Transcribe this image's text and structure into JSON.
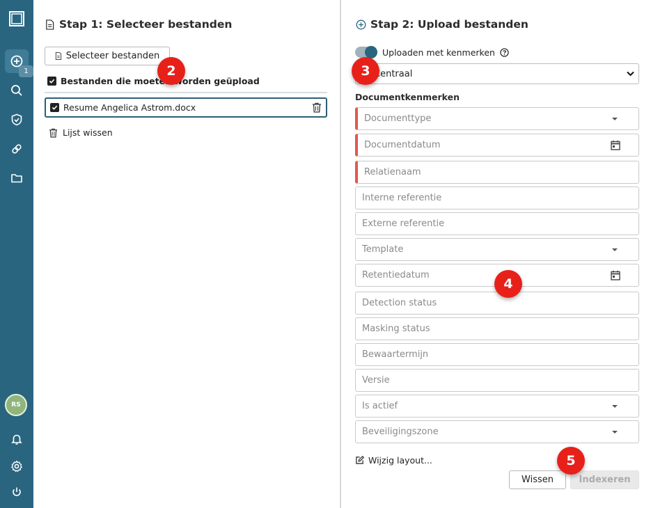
{
  "sidebar": {
    "badge_count": "1",
    "avatar_initials": "RS",
    "items": [
      {
        "name": "logo",
        "icon": "window-icon"
      },
      {
        "name": "upload",
        "icon": "plus-circle-icon"
      },
      {
        "name": "search",
        "icon": "search-icon"
      },
      {
        "name": "security",
        "icon": "shield-icon"
      },
      {
        "name": "integrations",
        "icon": "link-icon"
      },
      {
        "name": "folders",
        "icon": "folder-icon"
      },
      {
        "name": "notifications",
        "icon": "bell-icon"
      },
      {
        "name": "settings",
        "icon": "gear-icon"
      },
      {
        "name": "logout",
        "icon": "power-icon"
      }
    ]
  },
  "step1": {
    "title": "Stap 1: Selecteer bestanden",
    "select_button": "Selecteer bestanden",
    "list_header": "Bestanden die moeten worden geüpload",
    "files": [
      "Resume Angelica Astrom.docx"
    ],
    "clear_list": "Lijst wissen"
  },
  "step2": {
    "title": "Stap 2: Upload bestanden",
    "toggle_label": "Uploaden met kenmerken",
    "toggle_on": true,
    "select_value": "Centraal",
    "section_label": "Documentkenmerken",
    "fields": [
      {
        "placeholder": "Documenttype",
        "required": true,
        "kind": "dropdown"
      },
      {
        "placeholder": "Documentdatum",
        "required": true,
        "kind": "date"
      },
      {
        "placeholder": "Relatienaam",
        "required": true,
        "kind": "text"
      },
      {
        "placeholder": "Interne referentie",
        "required": false,
        "kind": "text"
      },
      {
        "placeholder": "Externe referentie",
        "required": false,
        "kind": "text"
      },
      {
        "placeholder": "Template",
        "required": false,
        "kind": "dropdown"
      },
      {
        "placeholder": "Retentiedatum",
        "required": false,
        "kind": "date"
      },
      {
        "placeholder": "Detection status",
        "required": false,
        "kind": "text"
      },
      {
        "placeholder": "Masking status",
        "required": false,
        "kind": "text"
      },
      {
        "placeholder": "Bewaartermijn",
        "required": false,
        "kind": "text"
      },
      {
        "placeholder": "Versie",
        "required": false,
        "kind": "text"
      },
      {
        "placeholder": "Is actief",
        "required": false,
        "kind": "dropdown"
      },
      {
        "placeholder": "Beveiligingszone",
        "required": false,
        "kind": "dropdown"
      }
    ],
    "edit_layout": "Wijzig layout...",
    "clear_button": "Wissen",
    "index_button": "Indexeren"
  },
  "markers": [
    "2",
    "3",
    "4",
    "5"
  ],
  "colors": {
    "sidebar": "#2a6580",
    "required": "#e05a50",
    "marker": "#e8201a"
  }
}
